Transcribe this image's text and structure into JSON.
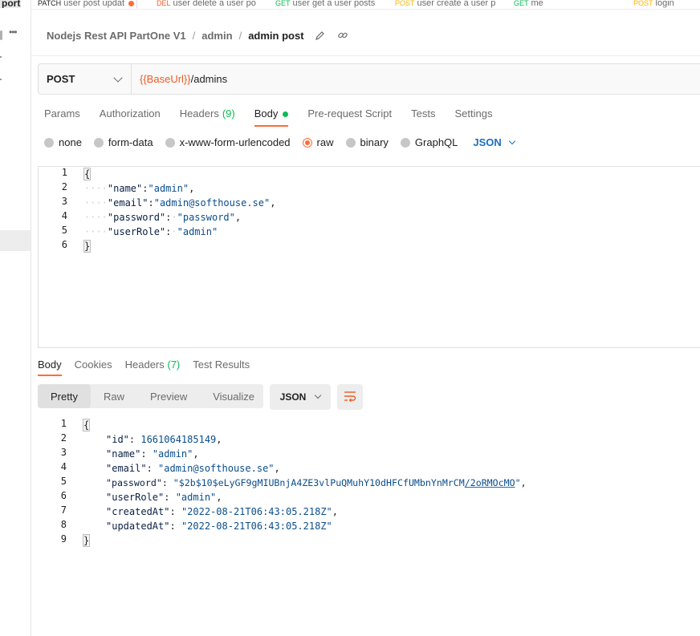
{
  "sidebar": {
    "port_label": "port",
    "more_label": "•••"
  },
  "tabs": [
    {
      "method": "PATCH",
      "label": "user post updat",
      "dirty": true
    },
    {
      "method": "DEL",
      "label": "user delete a user po"
    },
    {
      "method": "GET",
      "label": "user get a user posts"
    },
    {
      "method": "POST",
      "label": "user create a user p"
    },
    {
      "method": "GET",
      "label": "me"
    },
    {
      "method": "POST",
      "label": "login"
    }
  ],
  "breadcrumb": {
    "collection": "Nodejs Rest API PartOne V1",
    "folder": "admin",
    "request": "admin post",
    "separator": "/"
  },
  "request": {
    "method": "POST",
    "url_var": "{{BaseUrl}}",
    "url_path": "/admins"
  },
  "request_tabs": [
    {
      "label": "Params"
    },
    {
      "label": "Authorization"
    },
    {
      "label": "Headers",
      "count": "(9)"
    },
    {
      "label": "Body"
    },
    {
      "label": "Pre-request Script"
    },
    {
      "label": "Tests"
    },
    {
      "label": "Settings"
    }
  ],
  "body_types": [
    "none",
    "form-data",
    "x-www-form-urlencoded",
    "raw",
    "binary",
    "GraphQL"
  ],
  "body_lang": "JSON",
  "request_body": {
    "line_numbers": [
      "1",
      "2",
      "3",
      "4",
      "5",
      "6"
    ],
    "open": "{",
    "close": "}",
    "fields": [
      {
        "key": "\"name\"",
        "value": "\"admin\"",
        "sep": ":",
        "tail": ","
      },
      {
        "key": "\"email\"",
        "value": "\"admin@softhouse.se\"",
        "sep": ":",
        "tail": ","
      },
      {
        "key": "\"password\"",
        "value": "\"password\"",
        "sep": ":",
        "tail": ","
      },
      {
        "key": "\"userRole\"",
        "value": "\"admin\"",
        "sep": ":",
        "tail": ""
      }
    ]
  },
  "response_tabs": [
    {
      "label": "Body"
    },
    {
      "label": "Cookies"
    },
    {
      "label": "Headers",
      "count": "(7)"
    },
    {
      "label": "Test Results"
    }
  ],
  "view_modes": [
    "Pretty",
    "Raw",
    "Preview",
    "Visualize"
  ],
  "response_format": "JSON",
  "response_body": {
    "line_numbers": [
      "1",
      "2",
      "3",
      "4",
      "5",
      "6",
      "7",
      "8",
      "9"
    ],
    "open": "{",
    "close": "}",
    "fields": [
      {
        "key": "\"id\"",
        "value": "1661064185149",
        "tail": ","
      },
      {
        "key": "\"name\"",
        "value": "\"admin\"",
        "tail": ","
      },
      {
        "key": "\"email\"",
        "value": "\"admin@softhouse.se\"",
        "tail": ","
      },
      {
        "key": "\"password\"",
        "value": "\"$2b$10$eLyGF9gMIUBnjA4ZE3vlPuQMuhY10dHFCfUMbnYnMrCM",
        "value_link": "/2oRMOcMO",
        "value_end": "\"",
        "tail": ","
      },
      {
        "key": "\"userRole\"",
        "value": "\"admin\"",
        "tail": ","
      },
      {
        "key": "\"createdAt\"",
        "value": "\"2022-08-21T06:43:05.218Z\"",
        "tail": ","
      },
      {
        "key": "\"updatedAt\"",
        "value": "\"2022-08-21T06:43:05.218Z\"",
        "tail": ""
      }
    ]
  },
  "colors": {
    "accent": "#ff6c37",
    "green": "#0cbb52",
    "link": "#1d6fbd",
    "var": "#ef5b25"
  }
}
